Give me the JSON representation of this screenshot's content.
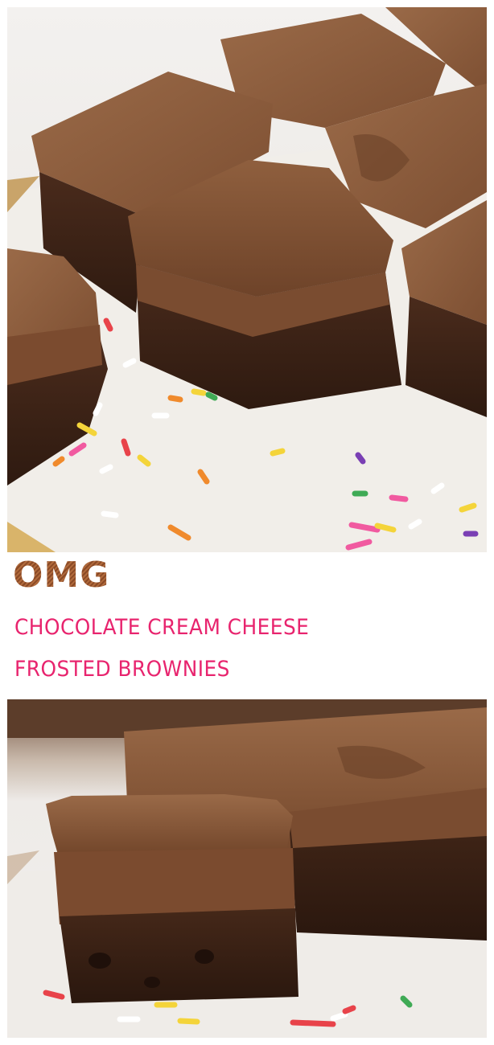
{
  "title": {
    "headline": "OMG",
    "line1": "CHOCOLATE CREAM CHEESE",
    "line2": "FROSTED BROWNIES"
  },
  "colors": {
    "headline": "#8b4a26",
    "subtitle": "#e8246e",
    "frosting": "#8a5a3c",
    "brownie": "#3e2418",
    "parchment": "#efece7"
  },
  "images": {
    "top": "brownie-squares-top-view",
    "bottom": "brownie-side-view"
  }
}
